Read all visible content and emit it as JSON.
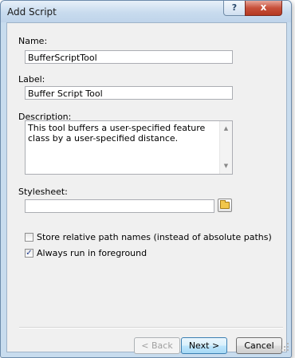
{
  "window": {
    "title": "Add Script",
    "help_label": "?",
    "close_label": "x"
  },
  "fields": {
    "name_label": "Name:",
    "name_value": "BufferScriptTool",
    "label_label": "Label:",
    "label_value": "Buffer Script Tool",
    "description_label": "Description:",
    "description_value": "This tool buffers a user-specified feature class by a user-specified distance.",
    "stylesheet_label": "Stylesheet:",
    "stylesheet_value": ""
  },
  "options": {
    "store_relative": {
      "label": "Store relative path names (instead of absolute paths)",
      "checked": false
    },
    "always_foreground": {
      "label": "Always run in foreground",
      "checked": true
    }
  },
  "buttons": {
    "back": "< Back",
    "next": "Next >",
    "cancel": "Cancel"
  },
  "icons": {
    "browse": "folder-icon",
    "help": "help-icon",
    "close": "close-icon"
  }
}
